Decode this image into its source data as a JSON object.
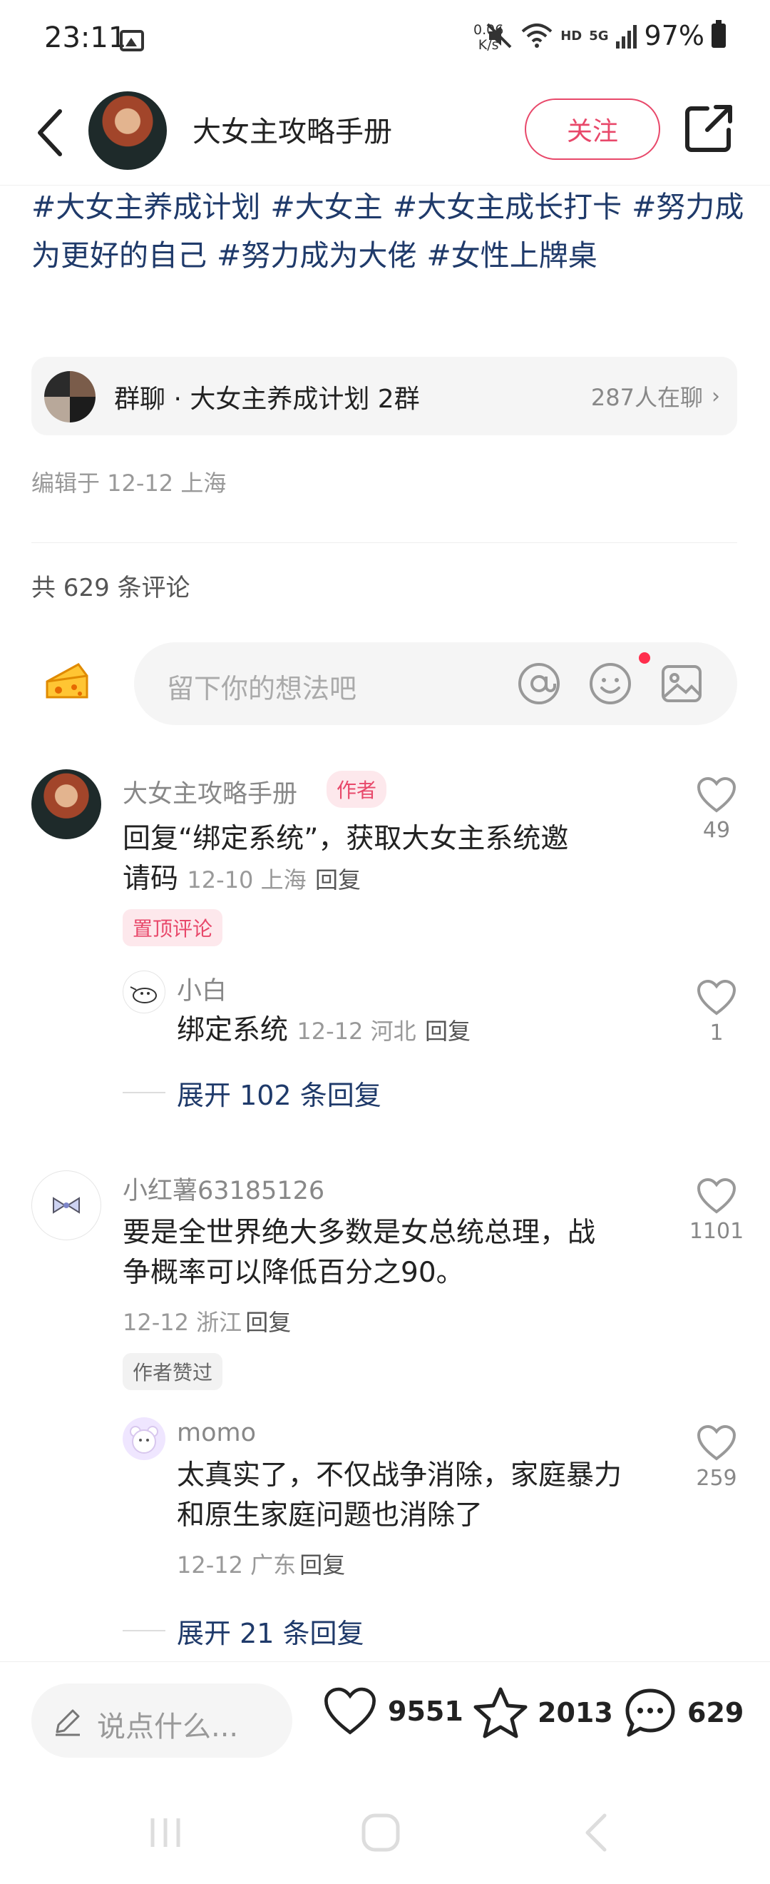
{
  "status_bar": {
    "time": "23:11",
    "net_speed_value": "0.06",
    "net_speed_unit": "K/s",
    "network_hd": "HD",
    "network_5g": "5G",
    "battery": "97%"
  },
  "header": {
    "title": "大女主攻略手册",
    "follow_label": "关注"
  },
  "tags": [
    "#大女主养成计划",
    "#大女主",
    "#大女主成长打卡",
    "#努力成为更好的自己",
    "#努力成为大佬",
    "#女性上牌桌"
  ],
  "group_chat": {
    "name": "群聊 · 大女主养成计划 2群",
    "online": "287人在聊"
  },
  "edited": "编辑于 12-12 上海",
  "comments_total": "共 629 条评论",
  "comment_input": {
    "placeholder": "留下你的想法吧"
  },
  "comments": [
    {
      "user": "大女主攻略手册",
      "badge": "作者",
      "text_line1": "回复“绑定系统”，获取大女主系统邀",
      "text_line2": "请码",
      "date": "12-10 上海",
      "reply": "回复",
      "tag": "置顶评论",
      "likes": "49",
      "sub_reply": {
        "user": "小白",
        "text": "绑定系统",
        "date": "12-12 河北",
        "reply": "回复",
        "likes": "1"
      },
      "expand": "展开 102 条回复"
    },
    {
      "user": "小红薯63185126",
      "text_line1": "要是全世界绝大多数是女总统总理，战",
      "text_line2": "争概率可以降低百分之90。",
      "date": "12-12 浙江",
      "reply": "回复",
      "tag": "作者赞过",
      "likes": "1101",
      "sub_reply": {
        "user": "momo",
        "text_line1": "太真实了，不仅战争消除，家庭暴力",
        "text_line2": "和原生家庭问题也消除了",
        "date": "12-12 广东",
        "reply": "回复",
        "likes": "259"
      },
      "expand": "展开 21 条回复"
    }
  ],
  "bottom_bar": {
    "say_placeholder": "说点什么...",
    "likes": "9551",
    "stars": "2013",
    "comments": "629"
  },
  "colors": {
    "accent": "#e8486a",
    "link": "#1f3a6a",
    "muted": "#999999"
  }
}
